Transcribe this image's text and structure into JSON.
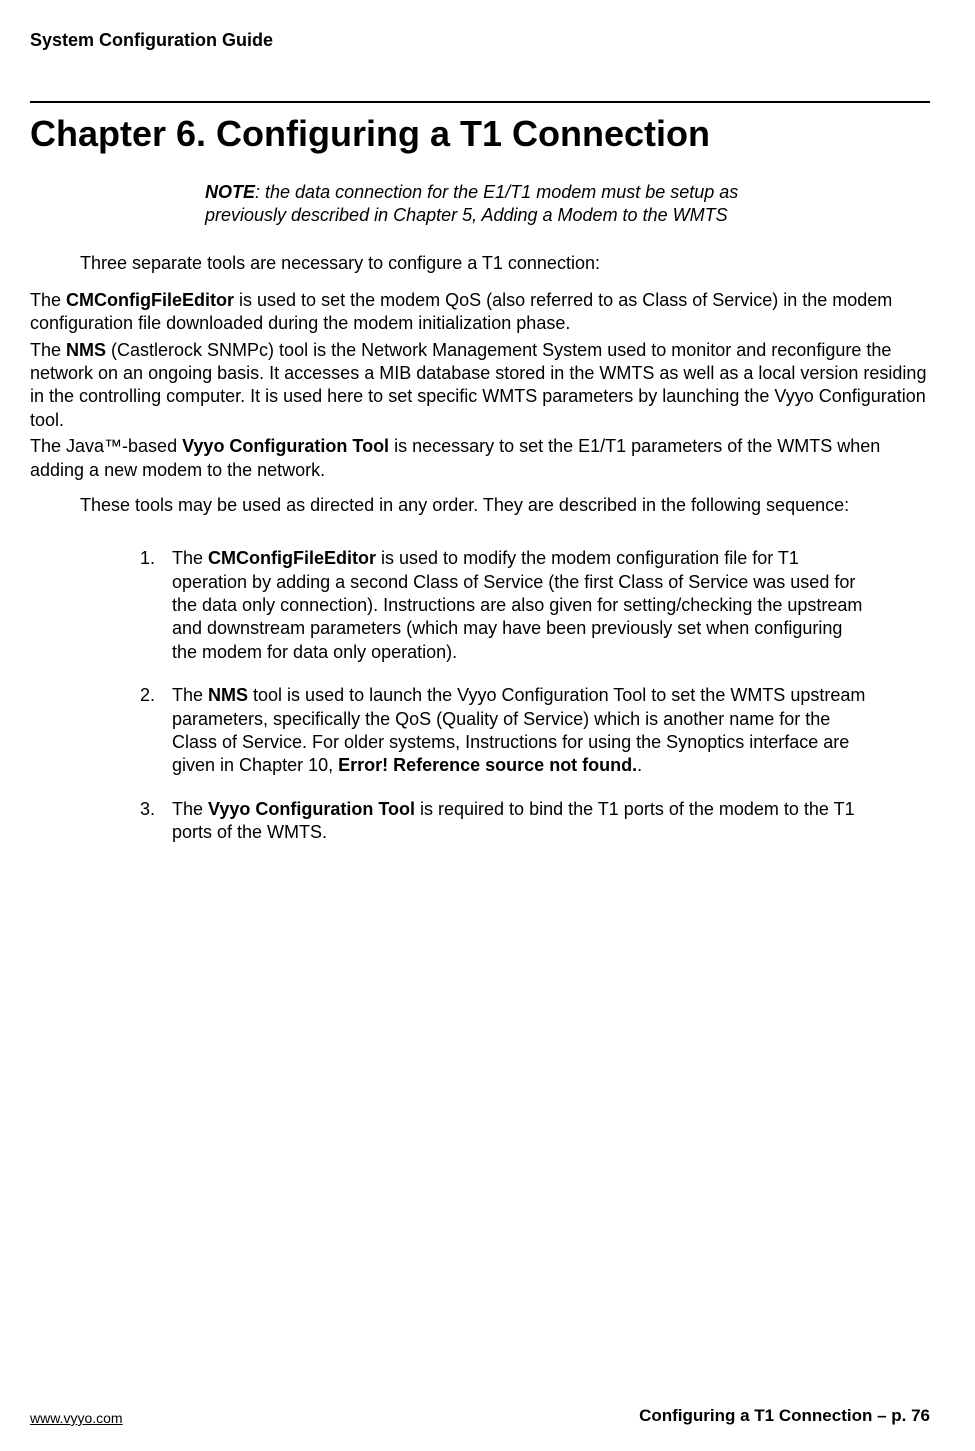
{
  "header": {
    "doc_title": "System Configuration Guide"
  },
  "chapter": {
    "title": "Chapter 6. Configuring a T1 Connection"
  },
  "note": {
    "label": "NOTE",
    "text": ":  the data connection for the E1/T1 modem must be setup as previously described in Chapter 5, Adding a Modem to the WMTS"
  },
  "intro": "Three separate tools are necessary to configure a T1 connection:",
  "tools": {
    "cm_prefix": "The ",
    "cm_bold": "CMConfigFileEditor",
    "cm_rest": " is used to set the modem QoS (also referred to as Class of Service) in the modem configuration file downloaded during the modem initialization phase.",
    "nms_prefix": "The ",
    "nms_bold": "NMS",
    "nms_rest": " (Castlerock SNMPc) tool is the Network Management System used to monitor and reconfigure the network on an ongoing basis.  It accesses a MIB database stored in the WMTS as well as a local version residing in the controlling computer.  It is used here to set specific WMTS parameters by launching the Vyyo Configuration tool.",
    "vyyo_prefix": "The Java™-based ",
    "vyyo_bold": "Vyyo Configuration Tool",
    "vyyo_rest": " is necessary to set the E1/T1 parameters of the WMTS when adding a new modem to the network."
  },
  "sequence_intro": "These tools may be used as directed in any order.  They are described in the following sequence:",
  "list": {
    "item1_prefix": "The ",
    "item1_bold": "CMConfigFileEditor",
    "item1_rest": " is used to modify the modem configuration file for T1 operation by adding a second Class of Service (the first Class of Service was used for the data only connection).  Instructions are also given for setting/checking the upstream and downstream parameters (which may have been previously set when configuring the modem for data only operation).",
    "item2_prefix": "The ",
    "item2_bold": "NMS",
    "item2_mid": " tool is used to launch the Vyyo Configuration Tool to set the WMTS upstream parameters, specifically the QoS (Quality of Service) which is another name for the Class of Service.  For older systems, Instructions for using the Synoptics interface are given in Chapter 10, ",
    "item2_bold2": "Error! Reference source not found.",
    "item2_end": ".",
    "item3_prefix": "The ",
    "item3_bold": "Vyyo Configuration Tool",
    "item3_rest": " is required to bind the T1 ports of the modem to the T1 ports of the WMTS."
  },
  "footer": {
    "url": "www.vyyo.com",
    "page": "Configuring a T1 Connection – p. 76"
  }
}
